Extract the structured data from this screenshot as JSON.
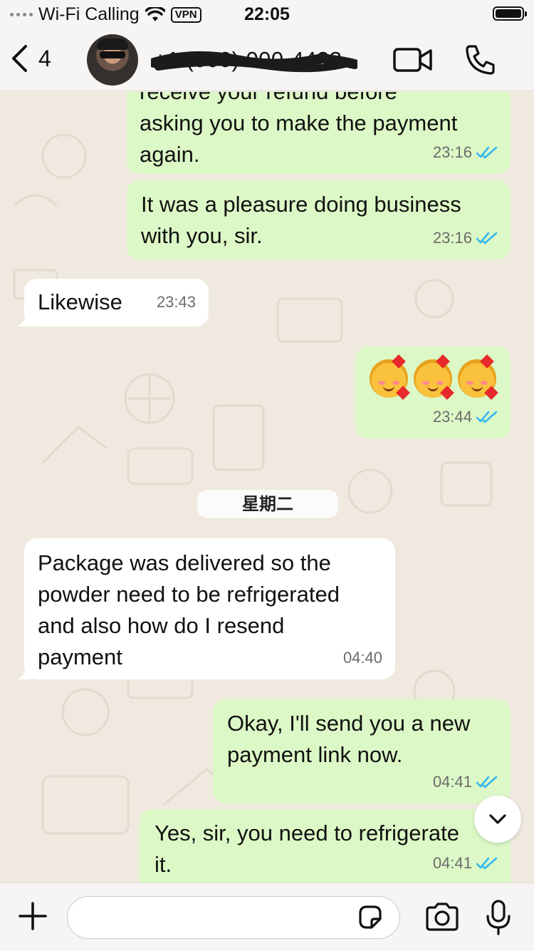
{
  "status_bar": {
    "carrier": "Wi-Fi Calling",
    "vpn": "VPN",
    "time": "22:05"
  },
  "header": {
    "back_count": "4",
    "contact_name": "+1 (000) 000-4423"
  },
  "messages": [
    {
      "direction": "out",
      "text_lines": [
        "receive your refund before",
        "asking you to make the payment",
        "again."
      ],
      "time": "23:16",
      "read": true
    },
    {
      "direction": "out",
      "text_lines": [
        "It was a pleasure doing business",
        "with you, sir."
      ],
      "time": "23:16",
      "read": true
    },
    {
      "direction": "in",
      "text_lines": [
        "Likewise"
      ],
      "time": "23:43"
    },
    {
      "direction": "out",
      "emoji": [
        "smiling-face-with-hearts",
        "smiling-face-with-hearts",
        "smiling-face-with-hearts"
      ],
      "time": "23:44",
      "read": true
    },
    {
      "direction": "in",
      "text_lines": [
        "Package was delivered so the",
        "powder need to be refrigerated",
        "and also how do I resend",
        "payment"
      ],
      "time": "04:40"
    },
    {
      "direction": "out",
      "text_lines": [
        "Okay, I'll send you a new",
        "payment link now."
      ],
      "time": "04:41",
      "read": true
    },
    {
      "direction": "out",
      "text_lines": [
        "Yes, sir, you need to refrigerate",
        "it."
      ],
      "time": "04:41",
      "read": true
    }
  ],
  "day_divider": "星期二",
  "input": {
    "placeholder": "",
    "value": ""
  },
  "colors": {
    "outgoing_bubble": "#dcf8c6",
    "incoming_bubble": "#ffffff",
    "read_ticks": "#34b7f1",
    "background": "#efe9df"
  }
}
